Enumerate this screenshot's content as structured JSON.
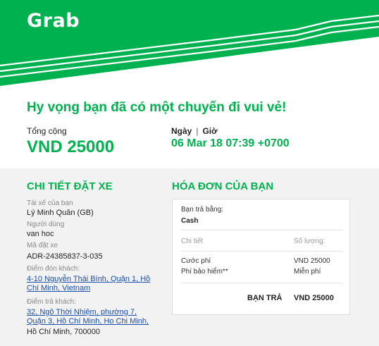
{
  "brand": {
    "logo_text": "Grab",
    "accent": "#00b14f"
  },
  "headline": "Hy vọng bạn đã có một chuyến đi vui vẻ!",
  "summary": {
    "total_label": "Tổng cộng",
    "total_value": "VND 25000",
    "date_label": "Ngày",
    "time_label": "Giờ",
    "datetime_value": "06 Mar 18 07:39 +0700"
  },
  "details": {
    "title": "CHI TIẾT ĐẶT XE",
    "driver_label": "Tài xế của bạn",
    "driver_value": "Lý Minh Quân (GB)",
    "user_label": "Người dùng",
    "user_value": "van hoc",
    "booking_label": "Mã đặt xe",
    "booking_value": "ADR-24385837-3-035",
    "pickup_label": "Điểm đón khách:",
    "pickup_value": "4-10 Nguyễn Thái Bình, Quận 1, Hồ Chí Minh, Vietnam",
    "dropoff_label": "Điểm trả khách:",
    "dropoff_link": "32, Ngô Thời Nhiệm, phường 7, Quận 3, Hồ Chí Minh, Ho Chi Minh,",
    "dropoff_tail": "Hồ Chí Minh, 700000"
  },
  "receipt": {
    "title": "HÓA ĐƠN CỦA BẠN",
    "paid_by_label": "Bạn trả bằng:",
    "paid_by_value": "Cash",
    "detail_header": "Chi tiết",
    "amount_header": "Số lượng:",
    "fare_label": "Cước phí",
    "fare_value": "VND 25000",
    "insurance_label": "Phí bảo hiểm**",
    "insurance_value": "Miễn phí",
    "total_label": "BẠN TRẢ",
    "total_value": "VND 25000"
  }
}
